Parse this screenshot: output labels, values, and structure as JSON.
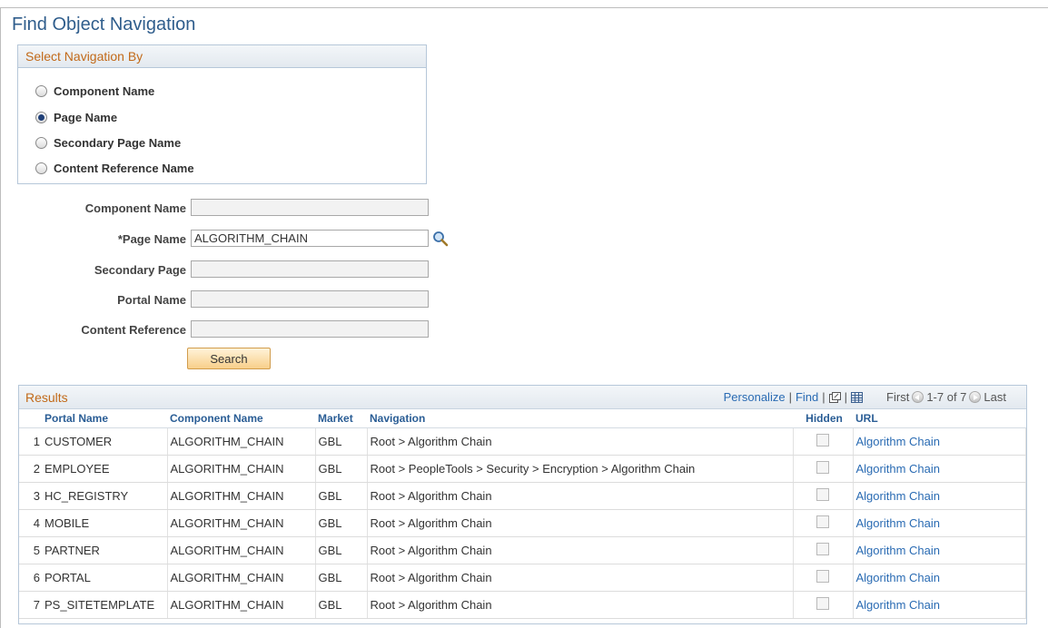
{
  "page_title": "Find Object Navigation",
  "select_nav": {
    "header": "Select Navigation By",
    "options": [
      {
        "label": "Component Name",
        "checked": false
      },
      {
        "label": "Page Name",
        "checked": true
      },
      {
        "label": "Secondary Page Name",
        "checked": false
      },
      {
        "label": "Content Reference Name",
        "checked": false
      }
    ]
  },
  "form": {
    "component_name": {
      "label": "Component Name",
      "value": ""
    },
    "page_name": {
      "label": "*Page Name",
      "value": "ALGORITHM_CHAIN"
    },
    "secondary_page": {
      "label": "Secondary Page",
      "value": ""
    },
    "portal_name": {
      "label": "Portal Name",
      "value": ""
    },
    "content_reference": {
      "label": "Content Reference",
      "value": ""
    }
  },
  "search_button": "Search",
  "results": {
    "title": "Results",
    "personalize": "Personalize",
    "find": "Find",
    "first": "First",
    "range": "1-7 of 7",
    "last": "Last",
    "columns": [
      "Portal Name",
      "Component Name",
      "Market",
      "Navigation",
      "Hidden",
      "URL"
    ],
    "rows": [
      {
        "num": "1",
        "portal": "CUSTOMER",
        "component": "ALGORITHM_CHAIN",
        "market": "GBL",
        "navigation": "Root > Algorithm Chain",
        "url": "Algorithm Chain"
      },
      {
        "num": "2",
        "portal": "EMPLOYEE",
        "component": "ALGORITHM_CHAIN",
        "market": "GBL",
        "navigation": "Root > PeopleTools > Security > Encryption > Algorithm Chain",
        "url": "Algorithm Chain"
      },
      {
        "num": "3",
        "portal": "HC_REGISTRY",
        "component": "ALGORITHM_CHAIN",
        "market": "GBL",
        "navigation": "Root > Algorithm Chain",
        "url": "Algorithm Chain"
      },
      {
        "num": "4",
        "portal": "MOBILE",
        "component": "ALGORITHM_CHAIN",
        "market": "GBL",
        "navigation": "Root > Algorithm Chain",
        "url": "Algorithm Chain"
      },
      {
        "num": "5",
        "portal": "PARTNER",
        "component": "ALGORITHM_CHAIN",
        "market": "GBL",
        "navigation": "Root > Algorithm Chain",
        "url": "Algorithm Chain"
      },
      {
        "num": "6",
        "portal": "PORTAL",
        "component": "ALGORITHM_CHAIN",
        "market": "GBL",
        "navigation": "Root > Algorithm Chain",
        "url": "Algorithm Chain"
      },
      {
        "num": "7",
        "portal": "PS_SITETEMPLATE",
        "component": "ALGORITHM_CHAIN",
        "market": "GBL",
        "navigation": "Root > Algorithm Chain",
        "url": "Algorithm Chain"
      }
    ]
  }
}
